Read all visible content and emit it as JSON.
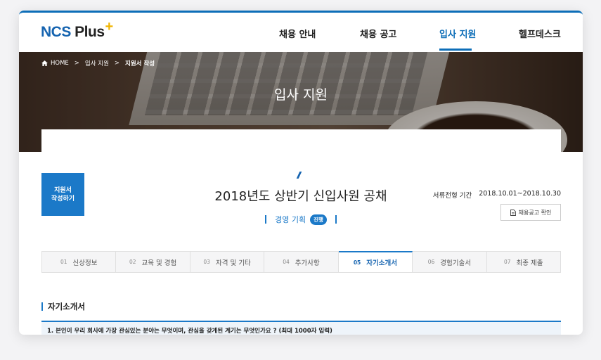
{
  "logo": {
    "ncs": "NCS",
    "plus": " Plus",
    "plus_sign": "+"
  },
  "nav": [
    {
      "label": "채용 안내",
      "active": false
    },
    {
      "label": "채용 공고",
      "active": false
    },
    {
      "label": "입사 지원",
      "active": true
    },
    {
      "label": "헬프데스크",
      "active": false
    }
  ],
  "breadcrumb": {
    "home": "HOME",
    "sep": ">",
    "level1": "입사 지원",
    "current": "지원서 작성"
  },
  "hero": {
    "title": "입사 지원"
  },
  "apply_badge": {
    "line1": "지원서",
    "line2": "작성하기"
  },
  "posting": {
    "title": "2018년도 상반기 신입사원 공채",
    "job": "경영 기획",
    "status": "진행",
    "period_label": "서류전형 기간",
    "period_value": "2018.10.01~2018.10.30",
    "notice_button": "채용공고 확인"
  },
  "steps": [
    {
      "num": "01",
      "label": "신상정보"
    },
    {
      "num": "02",
      "label": "교육 및 경험"
    },
    {
      "num": "03",
      "label": "자격 및 기타"
    },
    {
      "num": "04",
      "label": "추가사항"
    },
    {
      "num": "05",
      "label": "자기소개서"
    },
    {
      "num": "06",
      "label": "경험기술서"
    },
    {
      "num": "07",
      "label": "최종 제출"
    }
  ],
  "active_step": "05",
  "section": {
    "title": "자기소개서",
    "question": "1. 본인이 우리 회사에 가장 관심있는 분야는 무엇이며, 관심을 갖게된 계기는 무엇인가요 ? (최대 1000자 입력)"
  },
  "colors": {
    "accent": "#1b79c8",
    "nav_active": "#0d6eb8",
    "logo_plus": "#f0b400"
  }
}
